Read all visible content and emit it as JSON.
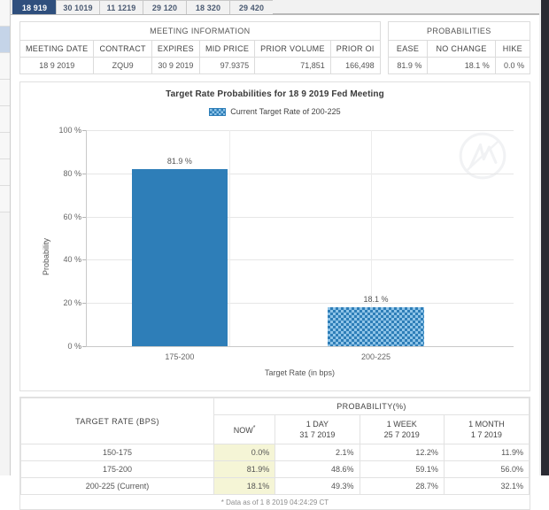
{
  "tabs": [
    {
      "label": "18 919",
      "active": true
    },
    {
      "label": "30 1019",
      "active": false
    },
    {
      "label": "11 1219",
      "active": false
    },
    {
      "label": "29 120",
      "active": false
    },
    {
      "label": "18 320",
      "active": false
    },
    {
      "label": "29 420",
      "active": false
    }
  ],
  "meeting_info": {
    "group_header": "MEETING INFORMATION",
    "columns": [
      "MEETING DATE",
      "CONTRACT",
      "EXPIRES",
      "MID PRICE",
      "PRIOR VOLUME",
      "PRIOR OI"
    ],
    "values": [
      "18 9 2019",
      "ZQU9",
      "30 9 2019",
      "97.9375",
      "71,851",
      "166,498"
    ]
  },
  "probabilities": {
    "group_header": "PROBABILITIES",
    "columns": [
      "EASE",
      "NO CHANGE",
      "HIKE"
    ],
    "values": [
      "81.9 %",
      "18.1 %",
      "0.0 %"
    ]
  },
  "chart_data": {
    "type": "bar",
    "title": "Target Rate Probabilities for 18 9 2019 Fed Meeting",
    "legend": {
      "label": "Current Target Rate of 200-225",
      "position": "top-center",
      "swatch": "checkered-blue"
    },
    "categories": [
      "175-200",
      "200-225"
    ],
    "values": [
      81.9,
      18.1
    ],
    "data_labels": [
      "81.9 %",
      "18.1 %"
    ],
    "xlabel": "Target Rate (in bps)",
    "ylabel": "Probability",
    "ylim": [
      0,
      100
    ],
    "yticks": [
      0,
      20,
      40,
      60,
      80,
      100
    ],
    "ytick_labels": [
      "0 %",
      "20 %",
      "40 %",
      "60 %",
      "80 %",
      "100 %"
    ],
    "grid": true,
    "colors": {
      "bar_solid": "#2e7eb8",
      "bar_hatch_light": "#8fc4e8",
      "bar_hatch_dark": "#2e7eb8"
    },
    "bar_styles": [
      "solid",
      "checkered"
    ]
  },
  "probability_table": {
    "rate_header": "TARGET RATE (BPS)",
    "prob_header": "PROBABILITY(%)",
    "sub_headers": [
      {
        "line1": "NOW",
        "line2": "",
        "sup": "*"
      },
      {
        "line1": "1 DAY",
        "line2": "31 7 2019",
        "sup": ""
      },
      {
        "line1": "1 WEEK",
        "line2": "25 7 2019",
        "sup": ""
      },
      {
        "line1": "1 MONTH",
        "line2": "1 7 2019",
        "sup": ""
      }
    ],
    "rows": [
      {
        "rate": "150-175",
        "now": "0.0%",
        "day": "2.1%",
        "week": "12.2%",
        "month": "11.9%"
      },
      {
        "rate": "175-200",
        "now": "81.9%",
        "day": "48.6%",
        "week": "59.1%",
        "month": "56.0%"
      },
      {
        "rate": "200-225 (Current)",
        "now": "18.1%",
        "day": "49.3%",
        "week": "28.7%",
        "month": "32.1%"
      }
    ],
    "footnote": "* Data as of 1 8 2019 04:24:29 CT"
  }
}
